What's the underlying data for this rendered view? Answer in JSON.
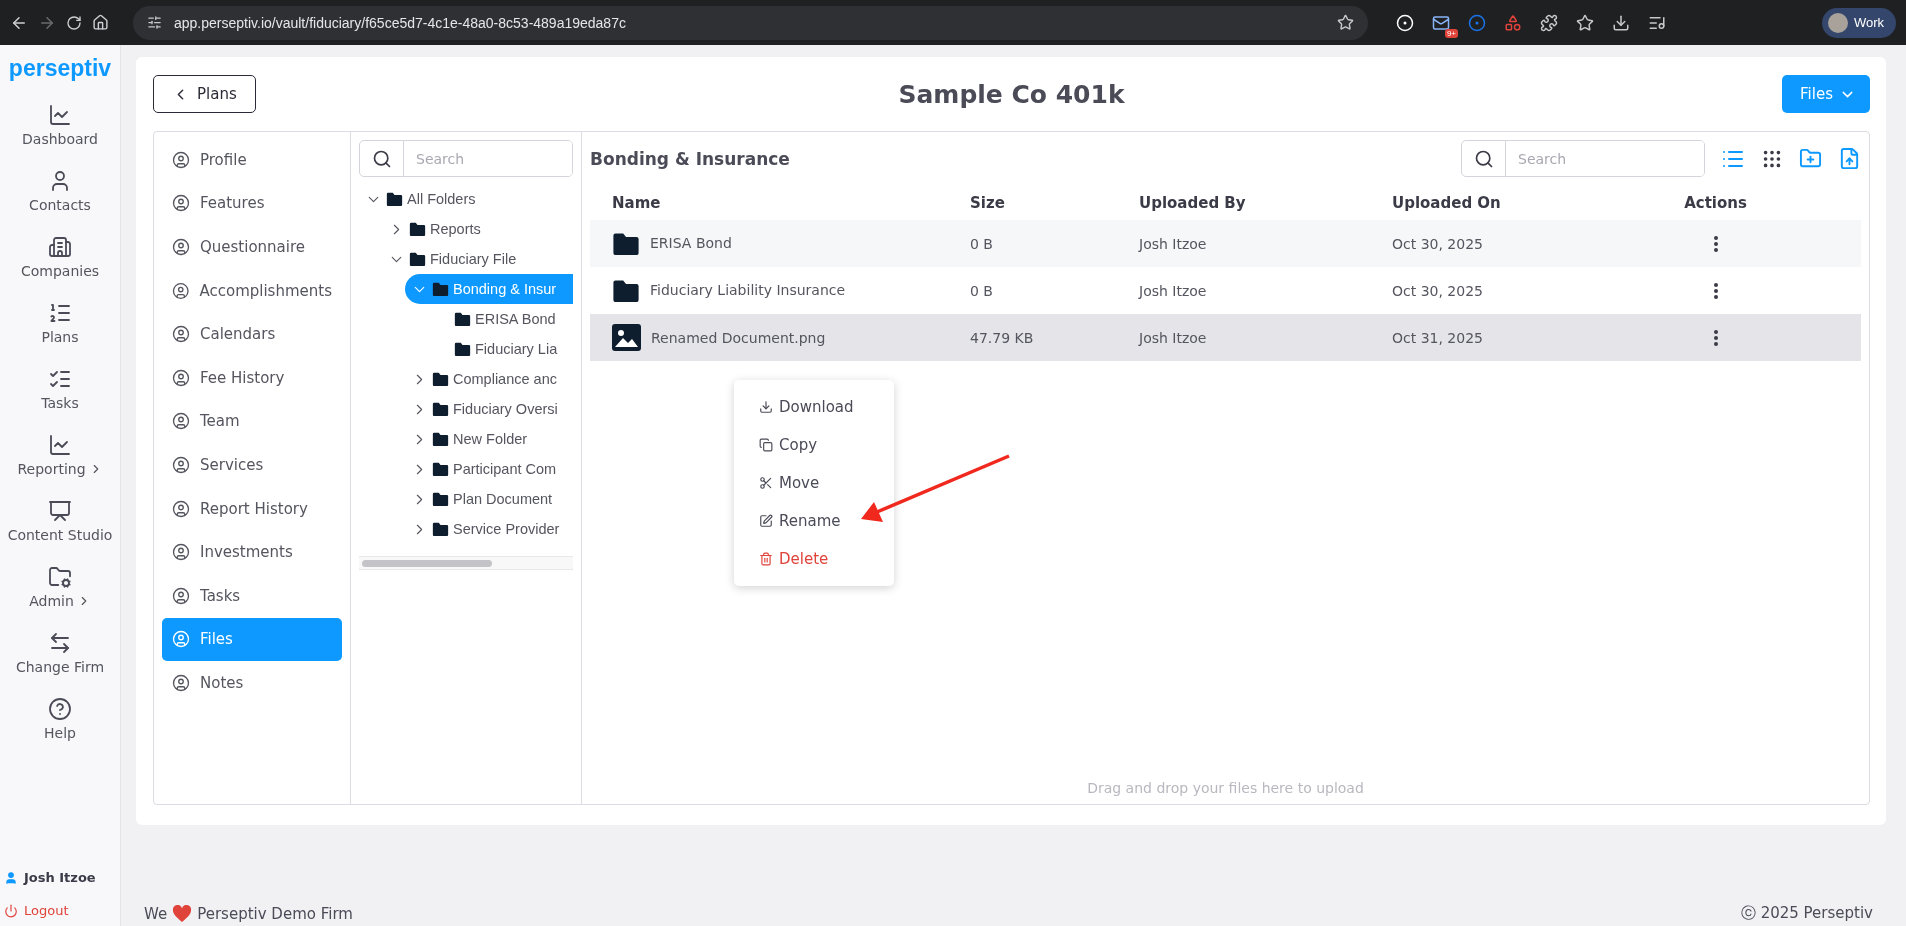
{
  "browser": {
    "url": "app.perseptiv.io/vault/fiduciary/f65ce5d7-4c1e-48a0-8c53-489a19eda87c",
    "extension_badge": "9+",
    "profile": "Work"
  },
  "sidebar": {
    "logo": "perseptiv",
    "items": [
      {
        "label": "Dashboard",
        "submenu": false
      },
      {
        "label": "Contacts",
        "submenu": false
      },
      {
        "label": "Companies",
        "submenu": false
      },
      {
        "label": "Plans",
        "submenu": false
      },
      {
        "label": "Tasks",
        "submenu": false
      },
      {
        "label": "Reporting",
        "submenu": true
      },
      {
        "label": "Content Studio",
        "submenu": false
      },
      {
        "label": "Admin",
        "submenu": true
      },
      {
        "label": "Change Firm",
        "submenu": false
      },
      {
        "label": "Help",
        "submenu": false
      }
    ],
    "user": "Josh Itzoe",
    "logout": "Logout"
  },
  "header": {
    "back": "Plans",
    "title": "Sample Co 401k",
    "menu": "Files"
  },
  "settings_nav": [
    {
      "label": "Profile",
      "selected": false
    },
    {
      "label": "Features",
      "selected": false
    },
    {
      "label": "Questionnaire",
      "selected": false
    },
    {
      "label": "Accomplishments",
      "selected": false
    },
    {
      "label": "Calendars",
      "selected": false
    },
    {
      "label": "Fee History",
      "selected": false
    },
    {
      "label": "Team",
      "selected": false
    },
    {
      "label": "Services",
      "selected": false
    },
    {
      "label": "Report History",
      "selected": false
    },
    {
      "label": "Investments",
      "selected": false
    },
    {
      "label": "Tasks",
      "selected": false
    },
    {
      "label": "Files",
      "selected": true
    },
    {
      "label": "Notes",
      "selected": false
    }
  ],
  "folder_tree": {
    "search_placeholder": "Search",
    "items": [
      {
        "label": "All Folders",
        "expanded": true,
        "selected": false,
        "children": [
          {
            "label": "Reports",
            "expanded": false,
            "selected": false
          },
          {
            "label": "Fiduciary File",
            "expanded": true,
            "selected": false,
            "children": [
              {
                "label": "Bonding & Insur",
                "expanded": true,
                "selected": true,
                "children": [
                  {
                    "label": "ERISA Bond",
                    "selected": false
                  },
                  {
                    "label": "Fiduciary Lia",
                    "selected": false
                  }
                ]
              },
              {
                "label": "Compliance anc",
                "expanded": false,
                "selected": false
              },
              {
                "label": "Fiduciary Oversi",
                "expanded": false,
                "selected": false
              },
              {
                "label": "New Folder",
                "expanded": false,
                "selected": false
              },
              {
                "label": "Participant Com",
                "expanded": false,
                "selected": false
              },
              {
                "label": "Plan Document",
                "expanded": false,
                "selected": false
              },
              {
                "label": "Service Provider",
                "expanded": false,
                "selected": false
              }
            ]
          }
        ]
      }
    ]
  },
  "files": {
    "title": "Bonding & Insurance",
    "search_placeholder": "Search",
    "columns": [
      "Name",
      "Size",
      "Uploaded By",
      "Uploaded On",
      "Actions"
    ],
    "rows": [
      {
        "kind": "folder",
        "name": "ERISA Bond",
        "size": "0 B",
        "uploaded_by": "Josh Itzoe",
        "uploaded_on": "Oct 30, 2025",
        "highlighted": false
      },
      {
        "kind": "folder",
        "name": "Fiduciary Liability Insurance",
        "size": "0 B",
        "uploaded_by": "Josh Itzoe",
        "uploaded_on": "Oct 30, 2025",
        "highlighted": false
      },
      {
        "kind": "image",
        "name": "Renamed Document.png",
        "size": "47.79 KB",
        "uploaded_by": "Josh Itzoe",
        "uploaded_on": "Oct 31, 2025",
        "highlighted": true
      }
    ],
    "drop_hint": "Drag and drop your files here to upload"
  },
  "context_menu": [
    {
      "label": "Download",
      "kind": "normal"
    },
    {
      "label": "Copy",
      "kind": "normal"
    },
    {
      "label": "Move",
      "kind": "normal"
    },
    {
      "label": "Rename",
      "kind": "normal"
    },
    {
      "label": "Delete",
      "kind": "danger"
    }
  ],
  "footer": {
    "left_before": "We",
    "left_after": "Perseptiv Demo Firm",
    "right": "ⓒ 2025 Perseptiv"
  }
}
